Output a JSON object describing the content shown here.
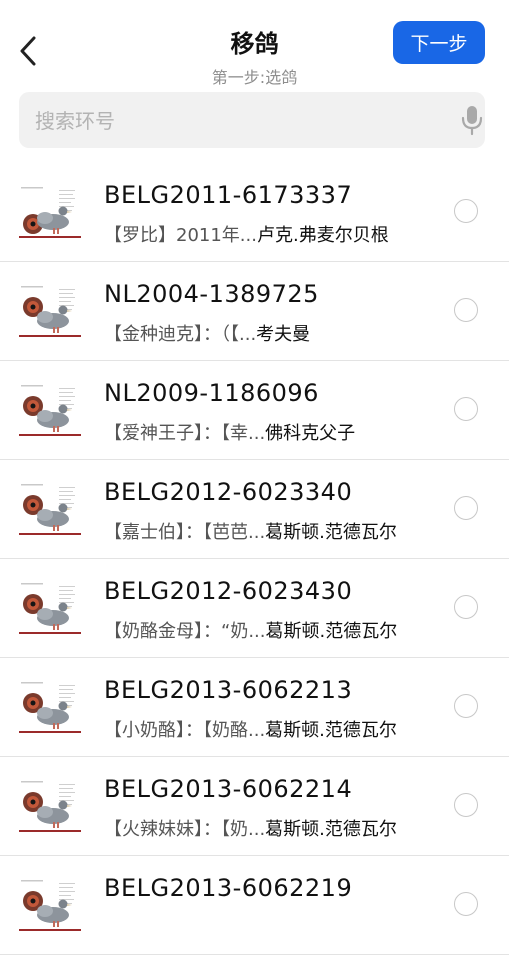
{
  "header": {
    "title": "移鸽",
    "subtitle": "第一步:选鸽",
    "next_label": "下一步",
    "back_icon": "chevron-left-icon"
  },
  "search": {
    "placeholder": "搜索环号",
    "icon": "microphone-icon"
  },
  "colors": {
    "accent": "#1967e6",
    "secondary_text": "#8e8e8e",
    "divider": "#e3e3e3"
  },
  "pigeons": [
    {
      "ring": "BELG2011-6173337",
      "desc": "【罗比】2011年...",
      "owner": "卢克.弗麦尔贝根",
      "selected": false
    },
    {
      "ring": "NL2004-1389725",
      "desc": "【金种迪克】：（【...",
      "owner": "考夫曼",
      "selected": false
    },
    {
      "ring": "NL2009-1186096",
      "desc": "【爱神王子】：【幸...",
      "owner": "佛科克父子",
      "selected": false
    },
    {
      "ring": "BELG2012-6023340",
      "desc": "【嘉士伯】：【芭芭...",
      "owner": "葛斯顿.范德瓦尔",
      "selected": false
    },
    {
      "ring": "BELG2012-6023430",
      "desc": "【奶酪金母】：“奶...",
      "owner": "葛斯顿.范德瓦尔",
      "selected": false
    },
    {
      "ring": "BELG2013-6062213",
      "desc": "【小奶酪】：【奶酪...",
      "owner": "葛斯顿.范德瓦尔",
      "selected": false
    },
    {
      "ring": "BELG2013-6062214",
      "desc": "【火辣妹妹】：【奶...",
      "owner": "葛斯顿.范德瓦尔",
      "selected": false
    },
    {
      "ring": "BELG2013-6062219",
      "desc": "",
      "owner": "",
      "selected": false
    }
  ]
}
